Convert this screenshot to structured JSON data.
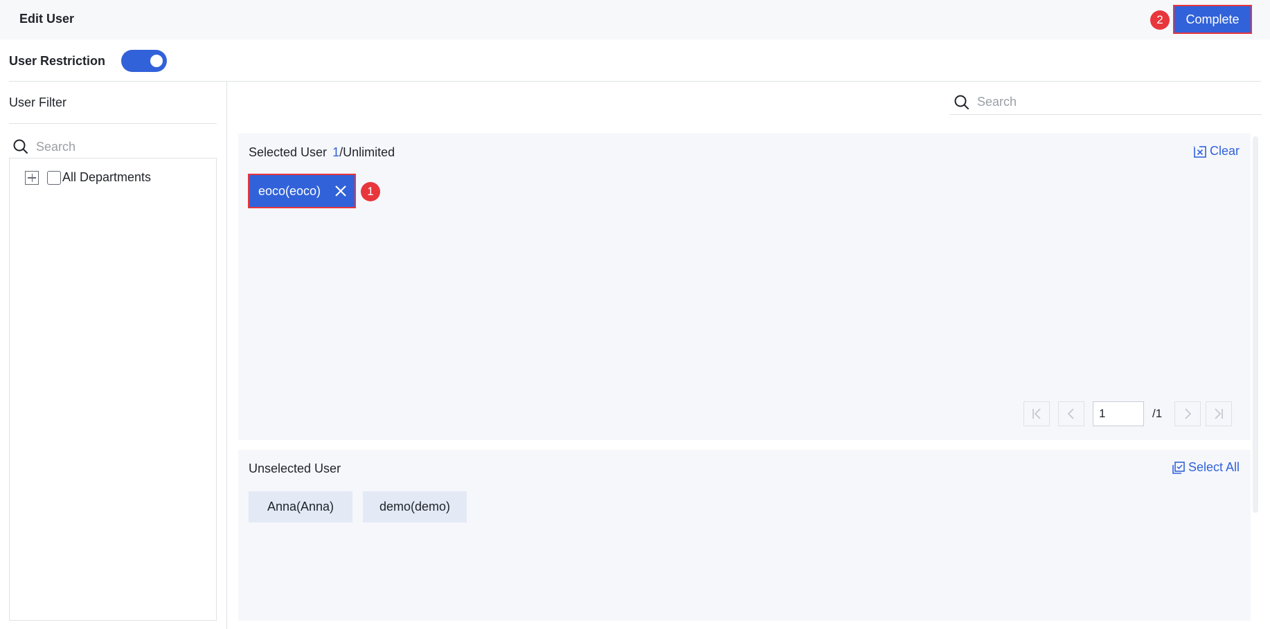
{
  "header": {
    "title": "Edit User",
    "complete_label": "Complete",
    "step_badge": "2"
  },
  "restriction": {
    "label": "User Restriction",
    "enabled": true
  },
  "filter": {
    "title": "User Filter",
    "search_placeholder": "Search",
    "tree": {
      "root_label": "All Departments",
      "checked": false,
      "expanded": false
    }
  },
  "main": {
    "search_placeholder": "Search",
    "selected": {
      "title": "Selected User",
      "count_current": "1",
      "count_limit": "/Unlimited",
      "clear_label": "Clear",
      "users": [
        "eoco(eoco)"
      ],
      "step_badge": "1",
      "pagination": {
        "current_page": "1",
        "total_pages": "/1"
      }
    },
    "unselected": {
      "title": "Unselected User",
      "select_all_label": "Select All",
      "users": [
        "Anna(Anna)",
        "demo(demo)"
      ]
    }
  },
  "colors": {
    "accent": "#3162d9",
    "highlight": "#e8363d",
    "panel_bg": "#f5f7fb",
    "chip_bg": "#e3e9f5"
  }
}
